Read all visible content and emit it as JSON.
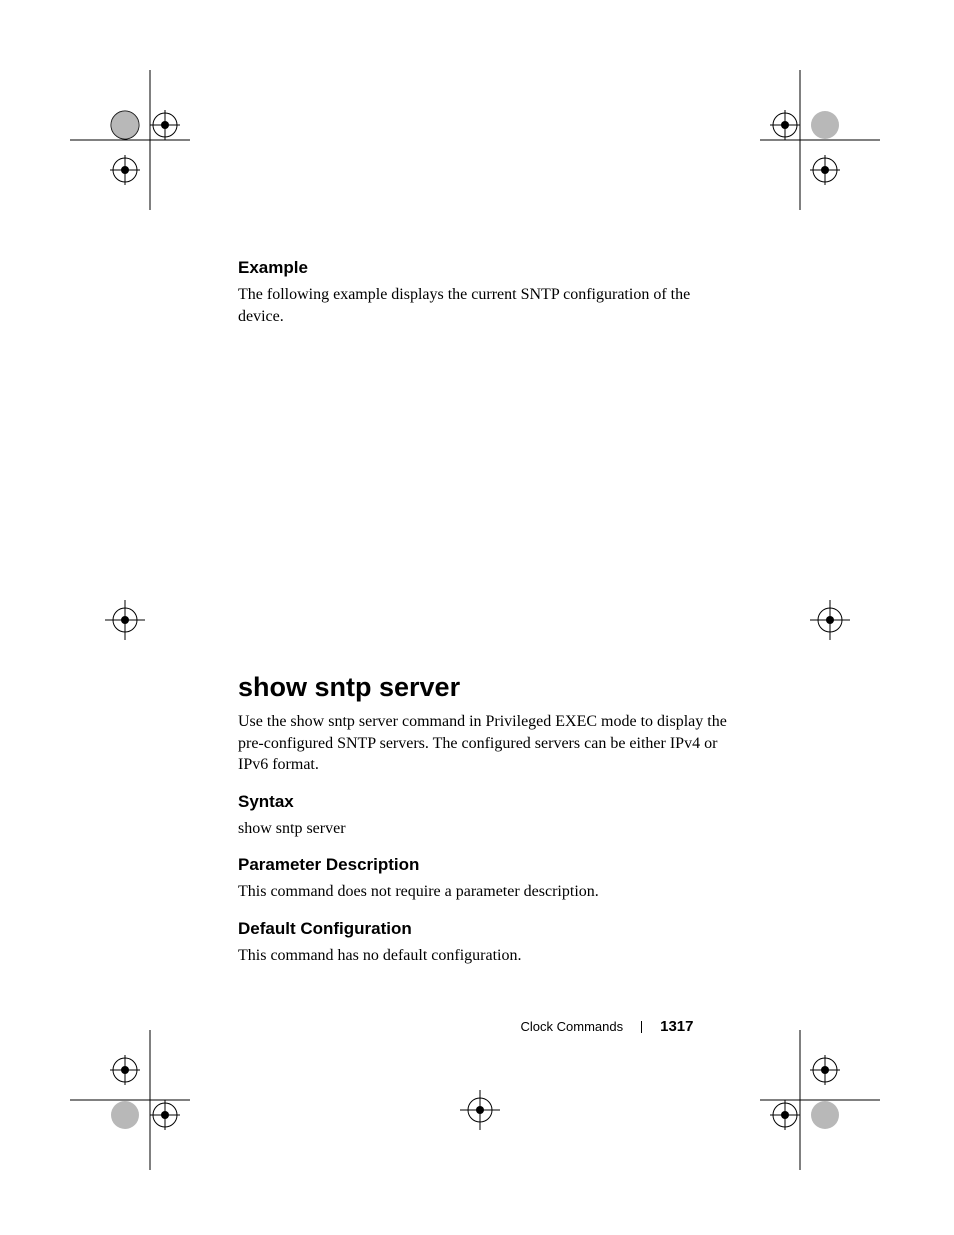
{
  "section1": {
    "heading": "Example",
    "body": "The following example displays the current SNTP configuration of the device."
  },
  "section2": {
    "heading": "show sntp server",
    "body": "Use the show sntp server command in Privileged EXEC mode to display the pre-configured SNTP servers. The configured servers can be either IPv4 or IPv6 format.",
    "syntax": {
      "heading": "Syntax",
      "body": "show sntp server"
    },
    "param_desc": {
      "heading": "Parameter Description",
      "body": "This command does not require a parameter description."
    },
    "default_config": {
      "heading": "Default Configuration",
      "body": "This command has no default configuration."
    }
  },
  "footer": {
    "section_name": "Clock Commands",
    "page_number": "1317"
  }
}
